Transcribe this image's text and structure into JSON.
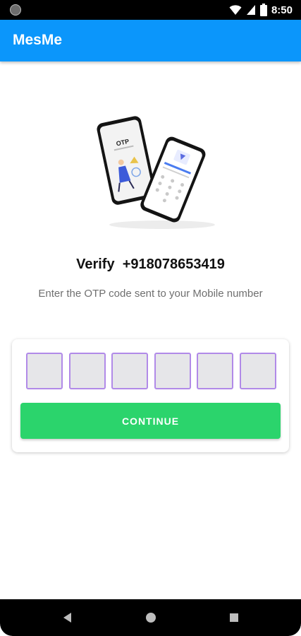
{
  "status_bar": {
    "time": "8:50"
  },
  "app_bar": {
    "title": "MesMe"
  },
  "hero": {
    "illustration_text": "OTP"
  },
  "verify": {
    "label": "Verify",
    "phone": "+918078653419"
  },
  "subtitle": "Enter the OTP code sent to your Mobile number",
  "otp": {
    "digits": [
      "",
      "",
      "",
      "",
      "",
      ""
    ]
  },
  "continue_label": "CONTINUE",
  "colors": {
    "app_bar": "#0b96fb",
    "otp_border": "#b18ae8",
    "otp_fill": "#e6e6e9",
    "continue": "#2bd46c"
  },
  "icons": {
    "status_left": "notification-dot-icon",
    "wifi": "wifi-icon",
    "signal": "signal-icon",
    "battery": "battery-icon",
    "back": "back-triangle-icon",
    "home": "home-circle-icon",
    "recents": "recents-square-icon"
  }
}
